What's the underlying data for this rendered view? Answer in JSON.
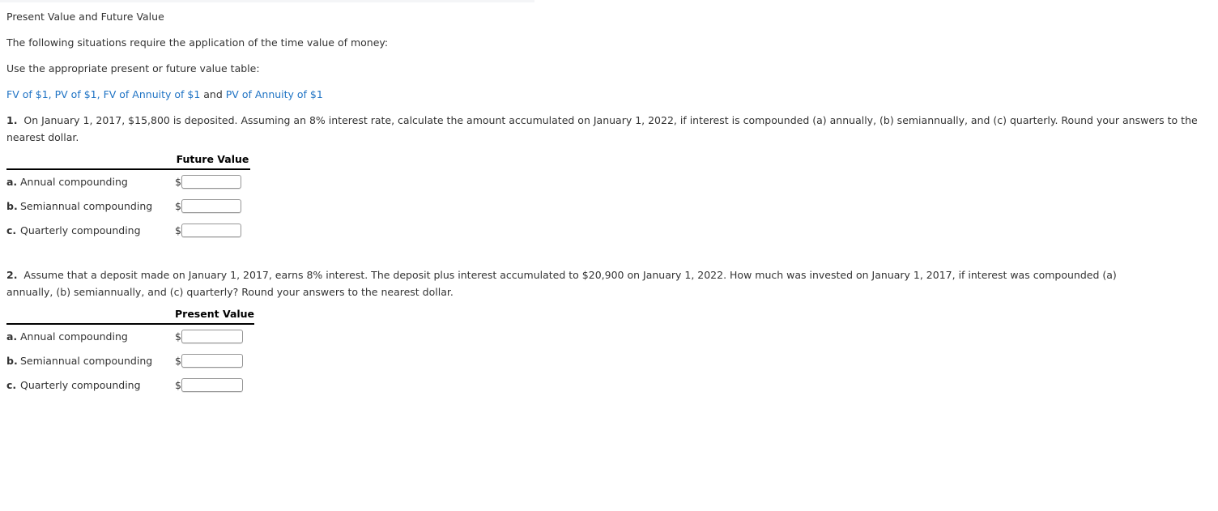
{
  "document": {
    "title": "Present Value and Future Value",
    "intro_line_1": "The following situations require the application of the time value of money:",
    "intro_line_2": "Use the appropriate present or future value table:",
    "links": {
      "fv_of_1": "FV of $1",
      "pv_of_1": "PV of $1",
      "fv_annuity_of_1": "FV of Annuity of $1",
      "pv_annuity_of_1": "PV of Annuity of $1",
      "separator": ", ",
      "conjunction": " and ",
      "color": "#1f73c4"
    }
  },
  "questions": [
    {
      "number": "1.",
      "text": "On January 1, 2017, $15,800 is deposited. Assuming an 8% interest rate, calculate the amount accumulated on January 1, 2022, if interest is compounded (a) annually, (b) semiannually, and (c) quarterly. Round your answers to the nearest dollar.",
      "table": {
        "column_header": "Future Value",
        "rows": [
          {
            "letter": "a.",
            "label": "Annual compounding",
            "currency": "$",
            "value": "",
            "placeholder": ""
          },
          {
            "letter": "b.",
            "label": "Semiannual compounding",
            "currency": "$",
            "value": "",
            "placeholder": ""
          },
          {
            "letter": "c.",
            "label": "Quarterly compounding",
            "currency": "$",
            "value": "",
            "placeholder": ""
          }
        ]
      }
    },
    {
      "number": "2.",
      "text": "Assume that a deposit made on January 1, 2017, earns 8% interest. The deposit plus interest accumulated to $20,900 on January 1, 2022. How much was invested on January 1, 2017, if interest was compounded (a) annually, (b) semiannually, and (c) quarterly? Round your answers to the nearest dollar.",
      "table": {
        "column_header": "Present Value",
        "rows": [
          {
            "letter": "a.",
            "label": "Annual compounding",
            "currency": "$",
            "value": "",
            "placeholder": ""
          },
          {
            "letter": "b.",
            "label": "Semiannual compounding",
            "currency": "$",
            "value": "",
            "placeholder": ""
          },
          {
            "letter": "c.",
            "label": "Quarterly compounding",
            "currency": "$",
            "value": "",
            "placeholder": ""
          }
        ]
      }
    }
  ]
}
